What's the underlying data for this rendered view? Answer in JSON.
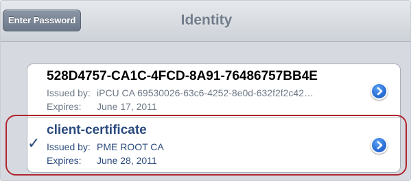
{
  "navbar": {
    "back_label": "Enter Password",
    "title": "Identity"
  },
  "certificates": [
    {
      "name": "528D4757-CA1C-4FCD-8A91-76486757BB4E",
      "issued_label": "Issued by:",
      "issuer": "iPCU CA 69530026-63c6-4252-8e0d-632f2f2c42…",
      "expires_label": "Expires:",
      "expires": "June 17, 2011",
      "selected": false
    },
    {
      "name": "client-certificate",
      "issued_label": "Issued by:",
      "issuer": "PME ROOT CA",
      "expires_label": "Expires:",
      "expires": "June 28, 2011",
      "selected": true
    }
  ],
  "icons": {
    "checkmark": "checkmark-icon",
    "disclosure": "disclosure-chevron-icon"
  },
  "colors": {
    "selected_text": "#2a4a7e",
    "disclosure_blue": "#2a6fd6",
    "highlight_red": "#b0242e"
  }
}
